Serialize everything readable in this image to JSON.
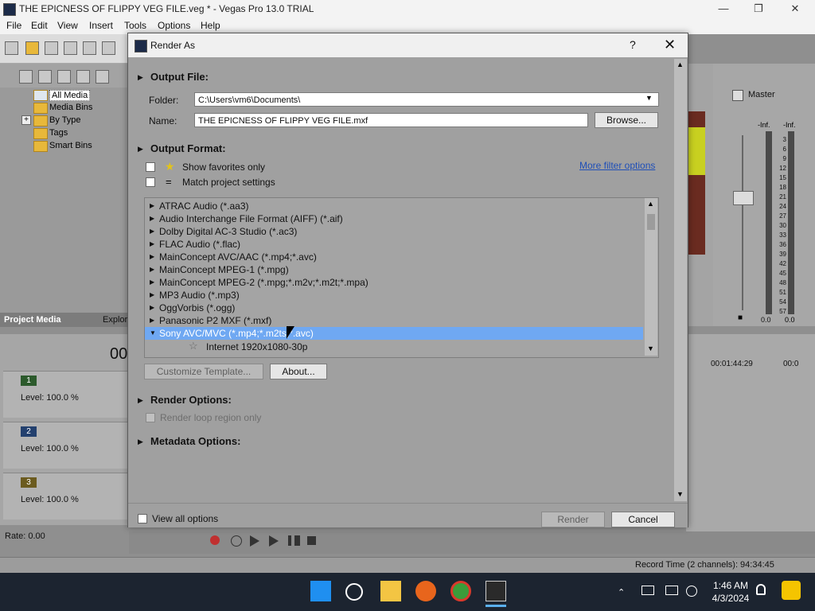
{
  "app": {
    "title": "THE EPICNESS OF FLIPPY VEG FILE.veg * - Vegas Pro 13.0 TRIAL",
    "window_controls": {
      "minimize": "—",
      "maximize": "❐",
      "close": "✕"
    }
  },
  "menu": [
    "File",
    "Edit",
    "View",
    "Insert",
    "Tools",
    "Options",
    "Help"
  ],
  "media_tree": [
    {
      "label": "All Media",
      "selected": true
    },
    {
      "label": "Media Bins"
    },
    {
      "label": "By Type",
      "expander": "+"
    },
    {
      "label": "Tags"
    },
    {
      "label": "Smart Bins"
    }
  ],
  "dock_tabs": {
    "project_media": "Project Media",
    "explorer": "Explor"
  },
  "timeline": {
    "timecode": "00",
    "tracks": [
      {
        "num": "1",
        "level": "Level: 100.0 %"
      },
      {
        "num": "2",
        "level": "Level: 100.0 %"
      },
      {
        "num": "3",
        "level": "Level: 100.0 %"
      }
    ],
    "rate": "Rate: 0.00",
    "ruler": [
      "00:01:44:29",
      "00:0"
    ]
  },
  "mixer": {
    "label": "Master",
    "scale": [
      "3",
      "6",
      "9",
      "12",
      "15",
      "18",
      "21",
      "24",
      "27",
      "30",
      "33",
      "36",
      "39",
      "42",
      "45",
      "48",
      "51",
      "54",
      "57"
    ],
    "inf_left": "-Inf.",
    "inf_right": "-Inf.",
    "val_left": "0.0",
    "val_right": "0.0"
  },
  "status": {
    "record_time": "Record Time (2 channels): 94:34:45"
  },
  "dialog": {
    "title": "Render As",
    "help": "?",
    "close": "✕",
    "output_file": {
      "heading": "Output File:",
      "folder_label": "Folder:",
      "folder_value": "C:\\Users\\vm6\\Documents\\",
      "name_label": "Name:",
      "name_value": "THE EPICNESS OF FLIPPY VEG FILE.mxf",
      "browse": "Browse..."
    },
    "output_format": {
      "heading": "Output Format:",
      "show_favorites": "Show favorites only",
      "match_project": "Match project settings",
      "more_filter": "More filter options",
      "formats": [
        "ATRAC Audio (*.aa3)",
        "Audio Interchange File Format (AIFF) (*.aif)",
        "Dolby Digital AC-3 Studio (*.ac3)",
        "FLAC Audio (*.flac)",
        "MainConcept AVC/AAC (*.mp4;*.avc)",
        "MainConcept MPEG-1 (*.mpg)",
        "MainConcept MPEG-2 (*.mpg;*.m2v;*.m2t;*.mpa)",
        "MP3 Audio (*.mp3)",
        "OggVorbis (*.ogg)",
        "Panasonic P2 MXF (*.mxf)",
        "Sony AVC/MVC (*.mp4;*.m2ts;*.avc)"
      ],
      "selected_index": 10,
      "template": "Internet 1920x1080-30p",
      "customize": "Customize Template...",
      "about": "About..."
    },
    "render_options": {
      "heading": "Render Options:",
      "loop_region": "Render loop region only"
    },
    "metadata_options": {
      "heading": "Metadata Options:"
    },
    "view_all": "View all options",
    "render": "Render",
    "cancel": "Cancel"
  },
  "taskbar": {
    "time": "1:46 AM",
    "date": "4/3/2024"
  },
  "colors": {
    "selection": "#6fa8f2",
    "link": "#1f4fb8"
  }
}
